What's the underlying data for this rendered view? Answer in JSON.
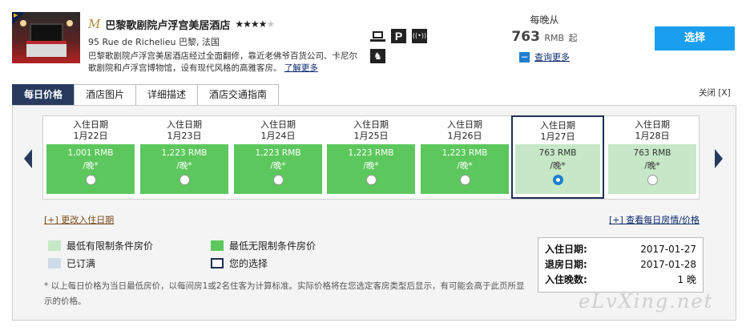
{
  "hotel": {
    "brand_logo": "M",
    "name": "巴黎歌剧院卢浮宫美居酒店",
    "stars_on": "★★★★",
    "stars_off": "★",
    "address": "95 Rue de Richelieu 巴黎, 法国",
    "description": "巴黎歌剧院卢浮宫美居酒店经过全面翻修，靠近老佛爷百货公司、卡尼尔歌剧院和卢浮宫博物馆，设有现代风格的高雅客房。",
    "more_link": "了解更多",
    "amenities": [
      "laptop-icon",
      "parking-icon",
      "wifi-icon",
      "pet-icon"
    ],
    "parking_glyph": "P",
    "wifi_glyph": "((•))",
    "pet_glyph": "♞"
  },
  "price": {
    "per_night_label": "每晚从",
    "amount": "763",
    "currency": "RMB",
    "suffix": "起",
    "more_toggle": "−",
    "more_label": "查询更多"
  },
  "select_button": "选择",
  "tabs": [
    {
      "label": "每日价格",
      "active": true
    },
    {
      "label": "酒店图片",
      "active": false
    },
    {
      "label": "详细描述",
      "active": false
    },
    {
      "label": "酒店交通指南",
      "active": false
    }
  ],
  "close_label": "关闭 [X]",
  "calendar": {
    "checkin_label": "入住日期",
    "days": [
      {
        "date": "1月22日",
        "price": "1,001 RMB",
        "per": "/晚*",
        "style": "green",
        "selected": false
      },
      {
        "date": "1月23日",
        "price": "1,223 RMB",
        "per": "/晚*",
        "style": "green",
        "selected": false
      },
      {
        "date": "1月24日",
        "price": "1,223 RMB",
        "per": "/晚*",
        "style": "green",
        "selected": false
      },
      {
        "date": "1月25日",
        "price": "1,223 RMB",
        "per": "/晚*",
        "style": "green",
        "selected": false
      },
      {
        "date": "1月26日",
        "price": "1,223 RMB",
        "per": "/晚*",
        "style": "green",
        "selected": false
      },
      {
        "date": "1月27日",
        "price": "763 RMB",
        "per": "/晚*",
        "style": "light",
        "selected": true
      },
      {
        "date": "1月28日",
        "price": "763 RMB",
        "per": "/晚*",
        "style": "light",
        "selected": false
      }
    ]
  },
  "change_date_link": "[+] 更改入住日期",
  "view_daily_link": "[+] 查看每日房情/价格",
  "legend": {
    "restricted": "最低有限制条件房价",
    "unrestricted": "最低无限制条件房价",
    "booked": "已订满",
    "your_choice": "您的选择"
  },
  "summary": {
    "checkin_label": "入住日期:",
    "checkin_value": "2017-01-27",
    "checkout_label": "退房日期:",
    "checkout_value": "2017-01-28",
    "nights_label": "入住晚数:",
    "nights_value": "1 晚"
  },
  "footnote": "* 以上每日价格为当日最低房价，以每间房1或2名住客为计算标准。实际价格将在您选定客房类型后显示，有可能会高于此页所显示的价格。",
  "watermark": "eLvXing.net",
  "colors": {
    "tab_active": "#283a5e",
    "select_button": "#1a9ff0",
    "green_unrestricted": "#5cc75c",
    "green_restricted": "#c6e8c6",
    "booked": "#cfdbe8"
  }
}
